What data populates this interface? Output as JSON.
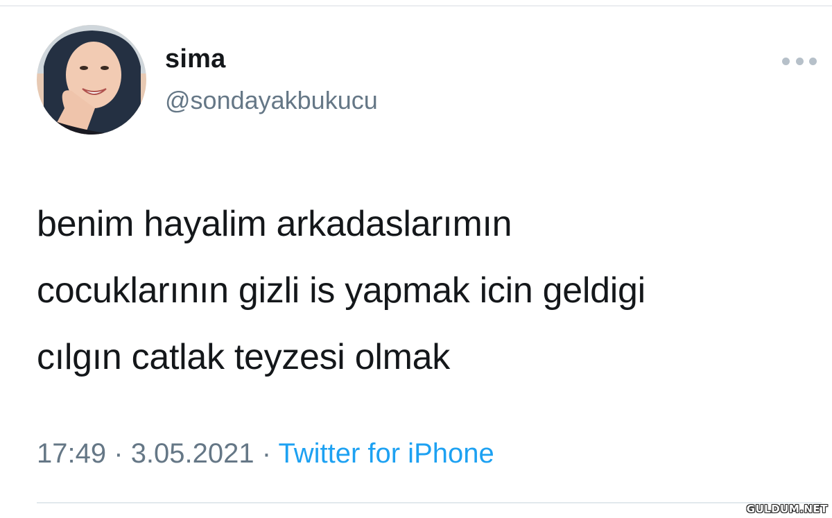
{
  "tweet": {
    "author": {
      "display_name": "sima",
      "handle": "@sondayakbukucu",
      "avatar_icon": "profile-photo"
    },
    "more_icon": "ellipsis-icon",
    "text_lines": [
      "benim hayalim arkadaslarımın",
      "cocuklarının gizli is yapmak icin geldigi",
      "cılgın catlak teyzesi olmak"
    ],
    "time": "17:49",
    "separator": "·",
    "date": "3.05.2021",
    "source": "Twitter for iPhone"
  },
  "watermark": "GULDUM.NET",
  "colors": {
    "text": "#14171a",
    "secondary": "#657786",
    "link": "#1da1f2"
  }
}
